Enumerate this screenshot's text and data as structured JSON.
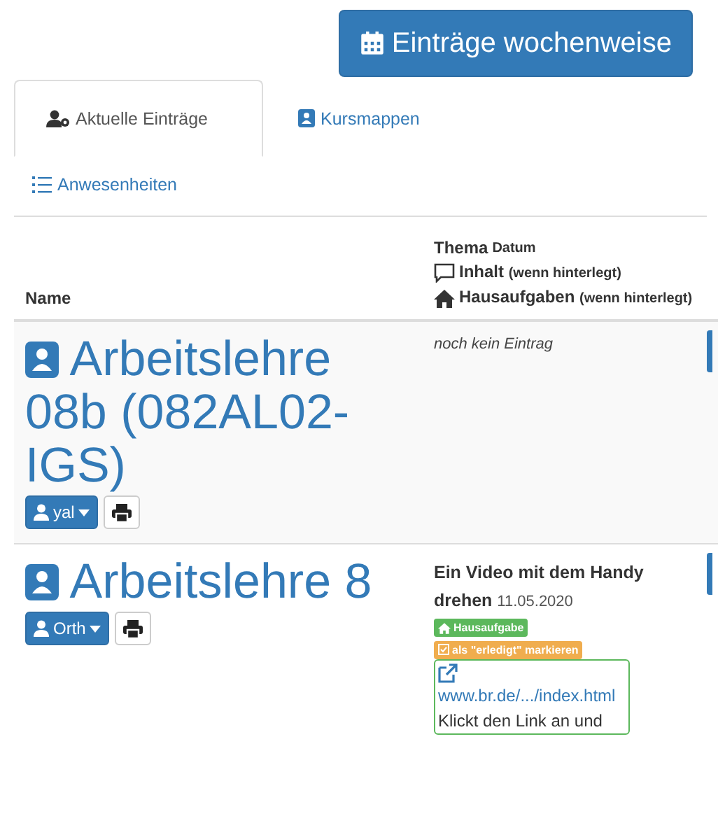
{
  "week_button": {
    "label": "Einträge wochenweise"
  },
  "tabs": [
    {
      "label": "Aktuelle Einträge",
      "kind": "users",
      "selected": true
    },
    {
      "label": "Kursmappen",
      "kind": "book",
      "selected": false
    },
    {
      "label": "Anwesenheiten",
      "kind": "list",
      "selected": false
    }
  ],
  "table": {
    "columns": [
      {
        "label": "Name"
      },
      {
        "parts": [
          {
            "text": "Thema",
            "kind": "strong"
          },
          {
            "text": "Datum",
            "kind": "small"
          }
        ],
        "lines": [
          {
            "kind": "comment",
            "label": "Inhalt",
            "note": "(wenn hinterlegt)"
          },
          {
            "kind": "home",
            "label": "Hausaufgaben",
            "note": "(wenn hinterlegt)"
          }
        ]
      }
    ],
    "rows": [
      {
        "course": "Arbeitslehre 08b (082AL02-IGS)",
        "teacher": "yal",
        "entry": {
          "kind": "empty",
          "text": "noch kein Eintrag"
        }
      },
      {
        "course": "Arbeitslehre 8",
        "teacher": "Orth",
        "entry": {
          "kind": "homework",
          "title": "Ein Video mit dem Handy drehen",
          "date": "11.05.2020",
          "badge": "Hausaufgabe",
          "mark": "als \"erledigt\" markieren",
          "link": "www.br.de/.../index.html",
          "text": "Klickt den Link an und"
        }
      }
    ]
  }
}
